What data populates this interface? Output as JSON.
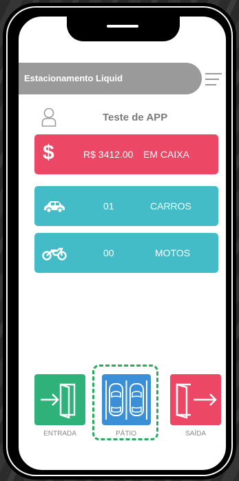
{
  "header": {
    "title": "Estacionamento Liquid"
  },
  "user": {
    "name": "Teste de APP"
  },
  "cards": {
    "caixa": {
      "value": "R$ 3412.00",
      "label": "EM CAIXA"
    },
    "carros": {
      "value": "01",
      "label": "CARROS"
    },
    "motos": {
      "value": "00",
      "label": "MOTOS"
    }
  },
  "actions": {
    "entrada": "ENTRADA",
    "patio": "PÁTIO",
    "saida": "SAÍDA"
  },
  "icons": {
    "dollar_symbol": "$"
  },
  "colors": {
    "header": "#9a9a9a",
    "caixa": "#ec4866",
    "counter": "#43bcc7",
    "entrada": "#2eb27a",
    "patio": "#3a8fd6",
    "saida": "#ec4866",
    "highlight": "#2ea85c"
  }
}
